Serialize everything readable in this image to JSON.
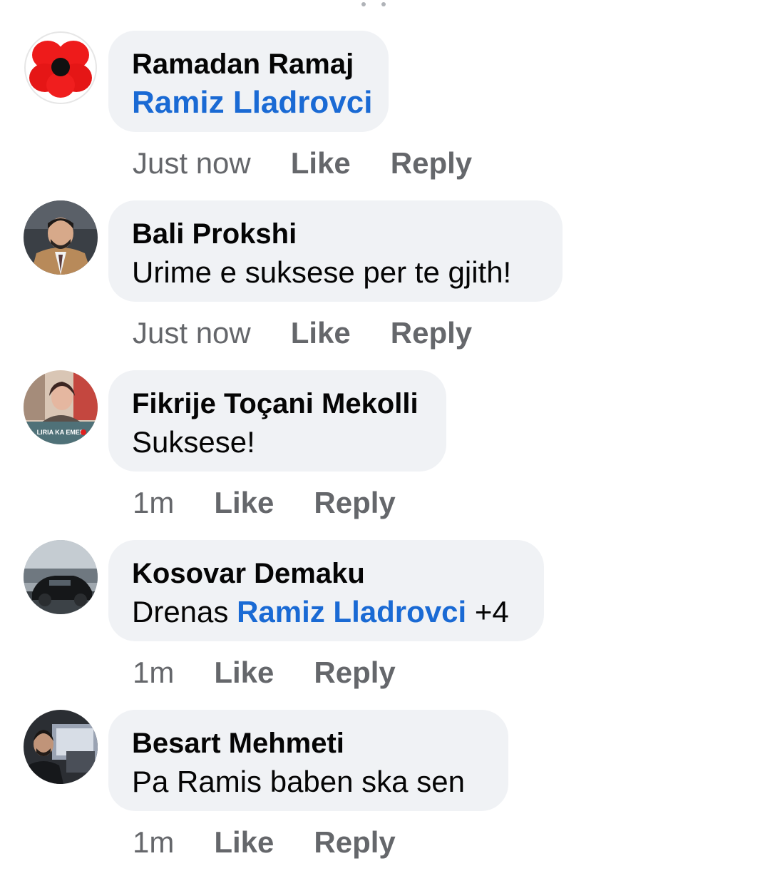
{
  "comments": [
    {
      "author": "Ramadan Ramaj",
      "text_mention": "Ramiz Lladrovci",
      "time": "Just now",
      "like_label": "Like",
      "reply_label": "Reply",
      "avatar_icon": "poppy-flower-avatar"
    },
    {
      "author": "Bali Prokshi",
      "text": "Urime e suksese per te gjith!",
      "time": "Just now",
      "like_label": "Like",
      "reply_label": "Reply",
      "avatar_icon": "man-in-suit-avatar"
    },
    {
      "author": "Fikrije Toçani Mekolli",
      "text": "Suksese!",
      "time": "1m",
      "like_label": "Like",
      "reply_label": "Reply",
      "avatar_icon": "woman-portrait-avatar",
      "avatar_caption": "LIRIA KA EMER"
    },
    {
      "author": "Kosovar Demaku",
      "text_prefix": "Drenas ",
      "text_mention": "Ramiz Lladrovci",
      "text_suffix": " +4",
      "time": "1m",
      "like_label": "Like",
      "reply_label": "Reply",
      "avatar_icon": "black-car-avatar"
    },
    {
      "author": "Besart Mehmeti",
      "text": "Pa Ramis baben ska sen",
      "time": "1m",
      "like_label": "Like",
      "reply_label": "Reply",
      "avatar_icon": "man-in-car-avatar"
    }
  ],
  "colors": {
    "bubble": "#f0f2f5",
    "mention": "#1a6ad4",
    "meta": "#65676b",
    "text": "#050505"
  }
}
